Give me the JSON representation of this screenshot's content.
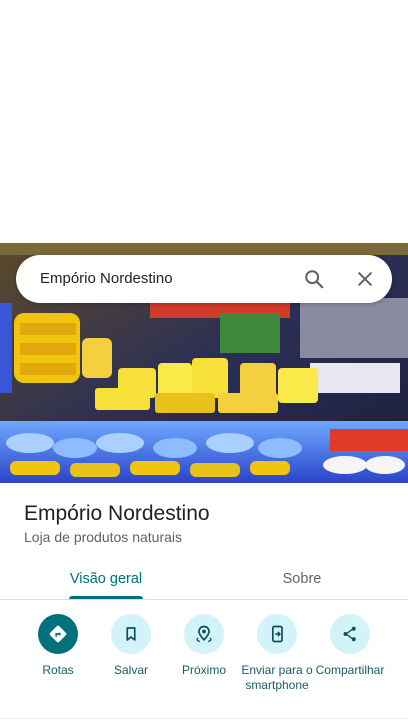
{
  "search": {
    "query": "Empório Nordestino"
  },
  "place": {
    "name": "Empório Nordestino",
    "category": "Loja de produtos naturais"
  },
  "tabs": [
    {
      "label": "Visão geral",
      "selected": true
    },
    {
      "label": "Sobre",
      "selected": false
    }
  ],
  "actions": [
    {
      "label": "Rotas",
      "icon": "directions-icon",
      "primary": true
    },
    {
      "label": "Salvar",
      "icon": "bookmark-icon",
      "primary": false
    },
    {
      "label": "Próximo",
      "icon": "nearby-icon",
      "primary": false
    },
    {
      "label": "Enviar para o smartphone",
      "icon": "send-to-phone-icon",
      "primary": false
    },
    {
      "label": "Compartilhar",
      "icon": "share-icon",
      "primary": false
    }
  ],
  "colors": {
    "accent": "#00707a",
    "action_bg": "#d2f3f8",
    "text_primary": "#202124",
    "text_secondary": "#5f6368"
  }
}
